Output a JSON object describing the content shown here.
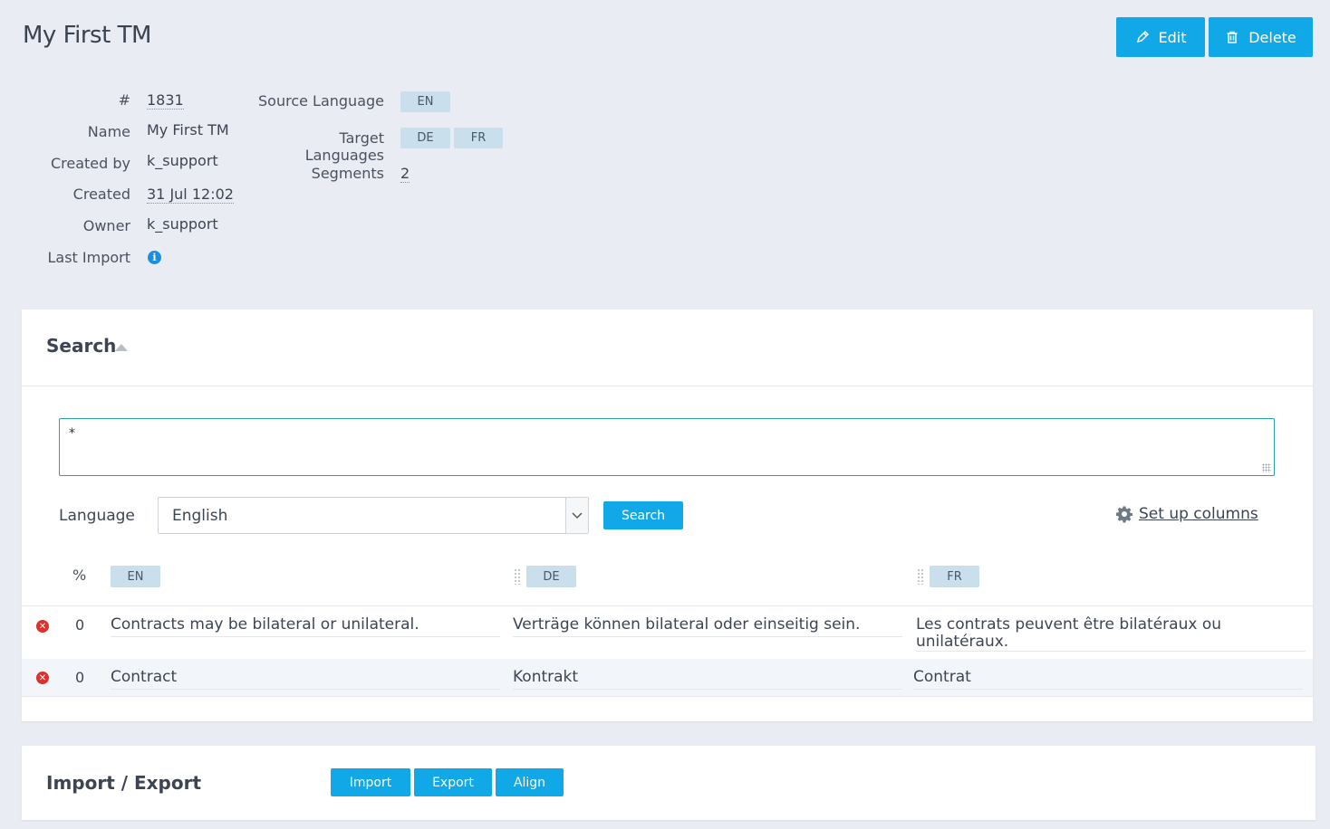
{
  "page": {
    "title": "My First TM",
    "edit_label": "Edit",
    "delete_label": "Delete"
  },
  "details": {
    "id_label": "#",
    "id_value": "1831",
    "name_label": "Name",
    "name_value": "My First TM",
    "created_by_label": "Created by",
    "created_by_value": "k_support",
    "created_label": "Created",
    "created_value": "31 Jul 12:02",
    "owner_label": "Owner",
    "owner_value": "k_support",
    "last_import_label": "Last Import",
    "source_language_label": "Source Language",
    "source_language": "EN",
    "target_languages_label": "Target Languages",
    "target_languages": [
      "DE",
      "FR"
    ],
    "segments_label": "Segments",
    "segments_value": "2"
  },
  "search": {
    "title": "Search",
    "query": "*",
    "language_label": "Language",
    "language_value": "English",
    "search_button": "Search",
    "setup_columns": "Set up columns",
    "columns": {
      "percent": "%",
      "langs": [
        "EN",
        "DE",
        "FR"
      ]
    },
    "rows": [
      {
        "percent": "0",
        "en": "Contracts may be bilateral or unilateral.",
        "de": "Verträge können bilateral oder einseitig sein.",
        "fr": "Les contrats peuvent être bilatéraux ou unilatéraux."
      },
      {
        "percent": "0",
        "en": "Contract",
        "de": "Kontrakt",
        "fr": "Contrat"
      }
    ]
  },
  "import_export": {
    "title": "Import / Export",
    "import_button": "Import",
    "export_button": "Export",
    "align_button": "Align"
  },
  "colors": {
    "accent": "#11a8e8",
    "tag_bg": "#c9dfec",
    "danger": "#e0302c",
    "page_bg": "#e9ecf3"
  }
}
